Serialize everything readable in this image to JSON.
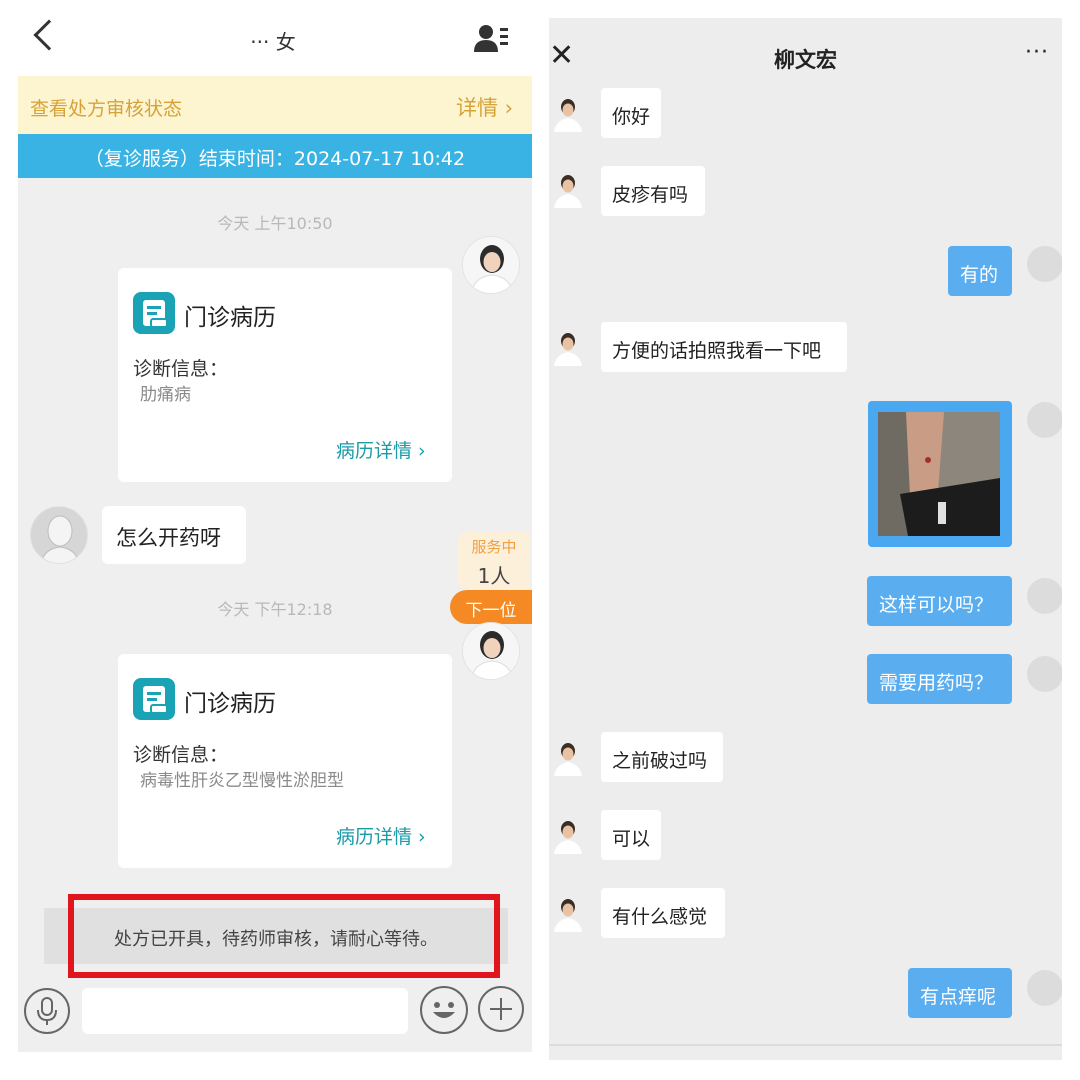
{
  "left": {
    "header": {
      "title": "··· 女"
    },
    "banner": {
      "text": "查看处方审核状态",
      "link": "详情 ›"
    },
    "service_bar": {
      "text": "（复诊服务）结束时间：2024-07-17 10:42"
    },
    "messages": {
      "time1": "今天 上午10:50",
      "card1": {
        "title": "门诊病历",
        "label": "诊断信息：",
        "value": "肋痛病",
        "link": "病历详情 ›"
      },
      "patient_msg": "怎么开药呀",
      "time2": "今天 下午12:18",
      "card2": {
        "title": "门诊病历",
        "label": "诊断信息：",
        "value": "病毒性肝炎乙型慢性淤胆型",
        "link": "病历详情 ›"
      },
      "notice": "处方已开具，待药师审核，请耐心等待。"
    },
    "queue": {
      "status": "服务中",
      "count": "1人",
      "next": "下一位"
    }
  },
  "right": {
    "header": {
      "close": "✕",
      "name": "柳文宏",
      "more": "···"
    },
    "messages": [
      {
        "from": "doctor",
        "text": "你好"
      },
      {
        "from": "doctor",
        "text": "皮疹有吗"
      },
      {
        "from": "patient",
        "text": "有的"
      },
      {
        "from": "doctor",
        "text": "方便的话拍照我看一下吧"
      },
      {
        "from": "patient",
        "type": "image"
      },
      {
        "from": "patient",
        "text": "这样可以吗？"
      },
      {
        "from": "patient",
        "text": "需要用药吗？"
      },
      {
        "from": "doctor",
        "text": "之前破过吗"
      },
      {
        "from": "doctor",
        "text": "可以"
      },
      {
        "from": "doctor",
        "text": "有什么感觉"
      },
      {
        "from": "patient",
        "text": "有点痒呢"
      }
    ]
  },
  "colors": {
    "service_bar": "#39b3e3",
    "banner_text": "#d8a23a",
    "card_icon": "#1aa3b4",
    "next_button": "#f58a24",
    "outgoing_bubble": "#5aaef0",
    "highlight_box": "#e0151d"
  },
  "icons": [
    "back-chevron-icon",
    "profile-icon",
    "medical-record-icon",
    "microphone-icon",
    "emoji-icon",
    "plus-icon",
    "close-icon",
    "more-icon"
  ]
}
